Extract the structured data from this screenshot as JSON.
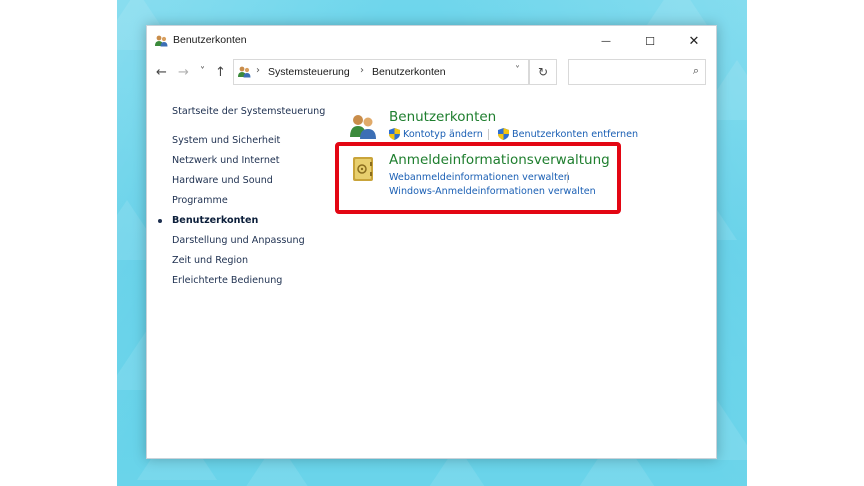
{
  "window": {
    "title": "Benutzerkonten"
  },
  "titlebar": {
    "minimize": "—",
    "maximize": "☐",
    "close": "✕"
  },
  "nav": {
    "back": "←",
    "forward": "→",
    "recent": "˅",
    "up": "↑",
    "breadcrumb": [
      "Systemsteuerung",
      "Benutzerkonten"
    ],
    "breadcrumb_sep": "›",
    "dropdown": "˅",
    "refresh": "↻",
    "search_placeholder": "",
    "search_icon": "⌕"
  },
  "sidebar": {
    "items": [
      {
        "label": "Startseite der Systemsteuerung",
        "active": false
      },
      {
        "label": "System und Sicherheit",
        "active": false
      },
      {
        "label": "Netzwerk und Internet",
        "active": false
      },
      {
        "label": "Hardware und Sound",
        "active": false
      },
      {
        "label": "Programme",
        "active": false
      },
      {
        "label": "Benutzerkonten",
        "active": true
      },
      {
        "label": "Darstellung und Anpassung",
        "active": false
      },
      {
        "label": "Zeit und Region",
        "active": false
      },
      {
        "label": "Erleichterte Bedienung",
        "active": false
      }
    ]
  },
  "categories": [
    {
      "title": "Benutzerkonten",
      "icon": "users-icon",
      "links": [
        "Kontotyp ändern",
        "Benutzerkonten entfernen"
      ]
    },
    {
      "title": "Anmeldeinformationsverwaltung",
      "icon": "credential-safe-icon",
      "links": [
        "Webanmeldeinformationen verwalten",
        "Windows-Anmeldeinformationen verwalten"
      ]
    }
  ],
  "colors": {
    "category_title": "#1e7e2e",
    "link": "#1a5fb4",
    "highlight": "#e30613",
    "desktop": "#5ecfe8"
  }
}
